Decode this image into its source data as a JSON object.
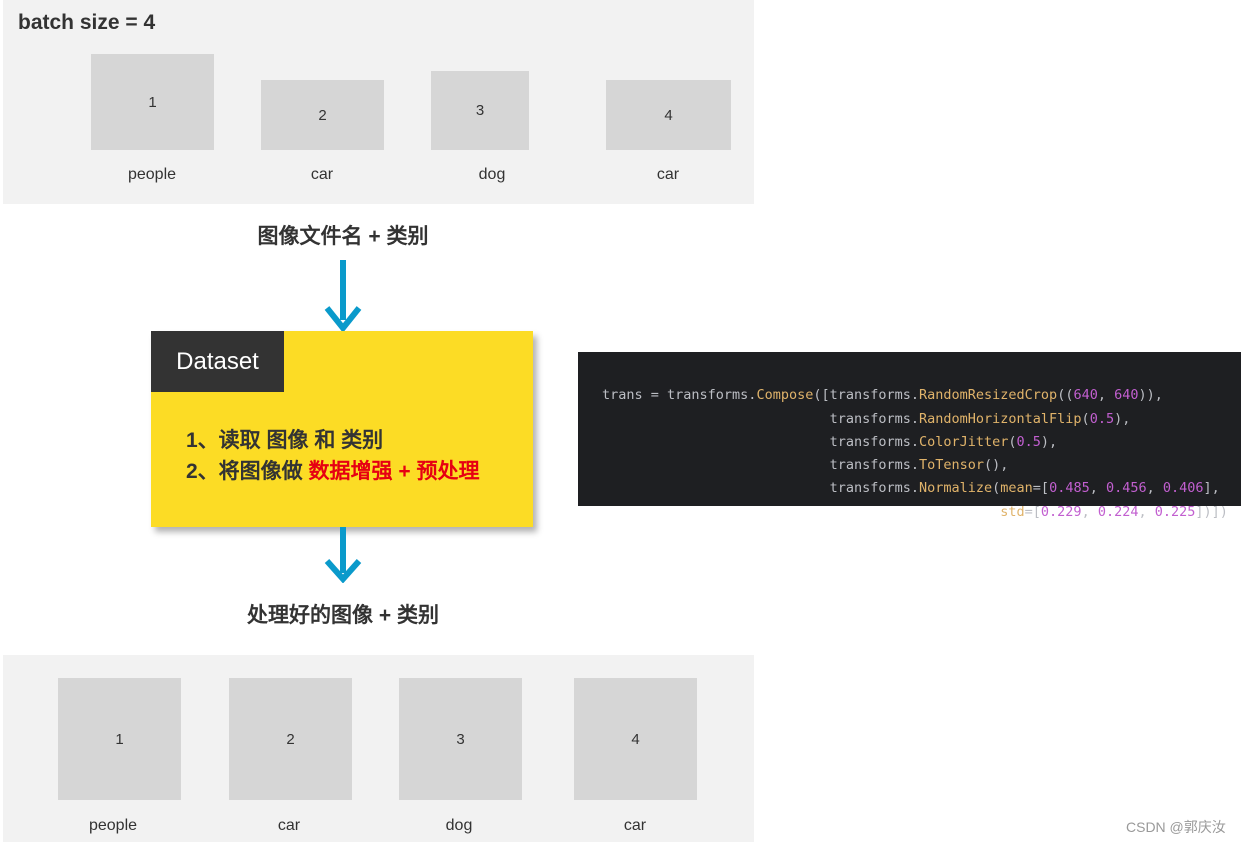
{
  "top_panel": {
    "title": "batch size = 4",
    "items": [
      {
        "id": "1",
        "label": "people"
      },
      {
        "id": "2",
        "label": "car"
      },
      {
        "id": "3",
        "label": "dog"
      },
      {
        "id": "4",
        "label": "car"
      }
    ]
  },
  "caption_top": "图像文件名 + 类别",
  "dataset": {
    "tab": "Dataset",
    "line1": "1、读取 图像 和 类别",
    "line2_prefix": "2、将图像做 ",
    "line2_highlight": "数据增强 + 预处理",
    "highlight_color": "#e60012",
    "box_color": "#fcdc25"
  },
  "caption_bottom": "处理好的图像 + 类别",
  "bottom_panel": {
    "items": [
      {
        "id": "1",
        "label": "people"
      },
      {
        "id": "2",
        "label": "car"
      },
      {
        "id": "3",
        "label": "dog"
      },
      {
        "id": "4",
        "label": "car"
      }
    ]
  },
  "arrow_color": "#0a9acb",
  "code": {
    "lines": [
      [
        "trans = transforms.",
        "Compose",
        "([transforms.",
        "RandomResizedCrop",
        "((",
        "640",
        ", ",
        "640",
        ")),"
      ],
      [
        "                            transforms.",
        "RandomHorizontalFlip",
        "(",
        "0.5",
        "),"
      ],
      [
        "                            transforms.",
        "ColorJitter",
        "(",
        "0.5",
        "),"
      ],
      [
        "                            transforms.",
        "ToTensor",
        "(),"
      ],
      [
        "                            transforms.",
        "Normalize",
        "(",
        "mean",
        "=[",
        "0.485",
        ", ",
        "0.456",
        ", ",
        "0.406",
        "],"
      ],
      [
        "                                                 ",
        "std",
        "=[",
        "0.229",
        ", ",
        "0.224",
        ", ",
        "0.225",
        "])])"
      ]
    ]
  },
  "watermark": "CSDN @郭庆汝"
}
